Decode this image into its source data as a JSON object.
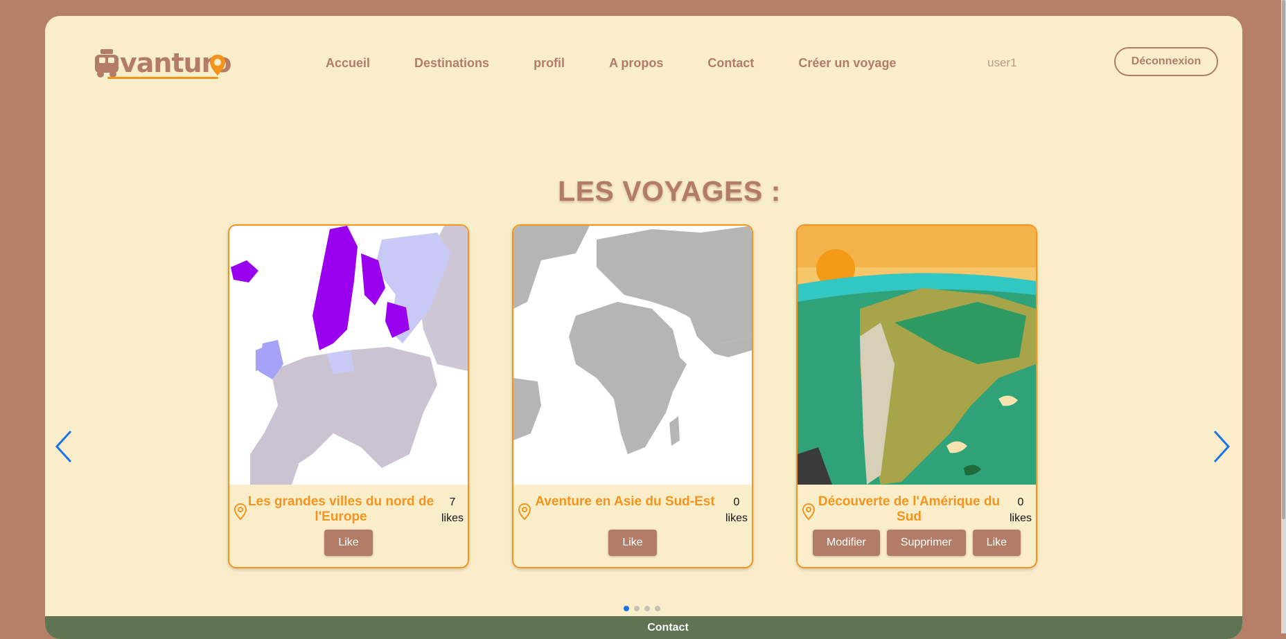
{
  "header": {
    "logo_text": "vanturo",
    "nav": [
      "Accueil",
      "Destinations",
      "profil",
      "A propos",
      "Contact",
      "Créer un voyage"
    ],
    "user": "user1",
    "logout_label": "Déconnexion"
  },
  "main": {
    "title": "LES VOYAGES :",
    "cards": [
      {
        "title": "Les grandes villes du nord de l'Europe",
        "likes_count": "7",
        "likes_label": "likes",
        "buttons": [
          "Like"
        ]
      },
      {
        "title": "Aventure en Asie du Sud-Est",
        "likes_count": "0",
        "likes_label": "likes",
        "buttons": [
          "Like"
        ]
      },
      {
        "title": "Découverte de l'Amérique du Sud",
        "likes_count": "0",
        "likes_label": "likes",
        "buttons": [
          "Modifier",
          "Supprimer",
          "Like"
        ]
      }
    ],
    "carousel": {
      "total_pages": 4,
      "active_page": 1
    }
  },
  "footer": {
    "title": "Contact"
  },
  "colors": {
    "background": "#b57f68",
    "panel": "#faeeca",
    "accent": "#f5941d",
    "brand": "#b27c66",
    "footer": "#5e7453",
    "active_dot": "#1a73e8"
  },
  "icons": {
    "prev": "chevron-left-icon",
    "next": "chevron-right-icon",
    "location": "map-pin-icon"
  }
}
